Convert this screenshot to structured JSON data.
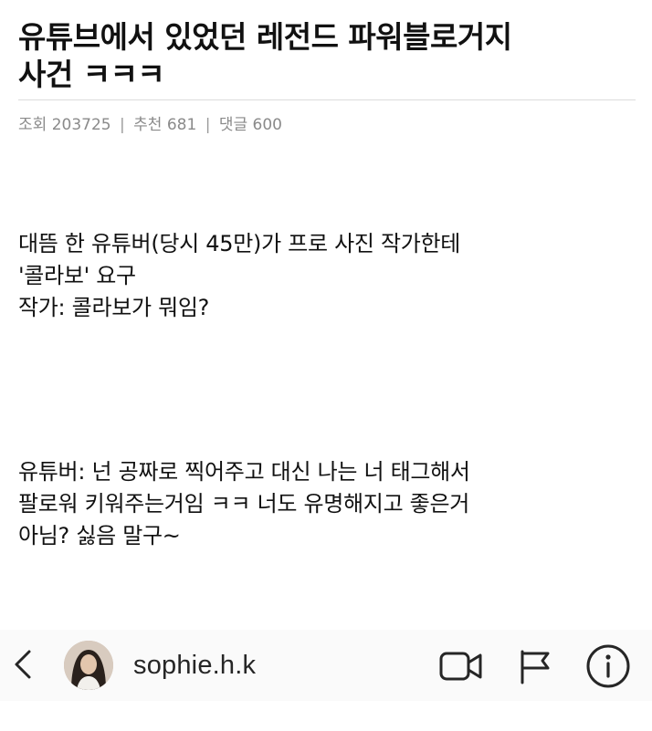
{
  "post": {
    "title_lines": [
      "유튜브에서 있었던 레전드 파워블로거지",
      "사건 ㅋㅋㅋ"
    ],
    "meta": {
      "views_label": "조회",
      "views": "203725",
      "recommend_label": "추천",
      "recommend": "681",
      "comments_label": "댓글",
      "comments": "600",
      "separator": "|"
    },
    "content": {
      "block1": [
        "대뜸 한 유튜버(당시 45만)가 프로 사진 작가한테",
        "'콜라보' 요구",
        "작가: 콜라보가 뭐임?"
      ],
      "block2": [
        "유튜버: 넌 공짜로 찍어주고 대신 나는 너 태그해서",
        "팔로워 키워주는거임 ㅋㅋ 너도 유명해지고 좋은거",
        "아님? 싫음 말구~"
      ]
    }
  },
  "instagram_bar": {
    "username": "sophie.h.k",
    "icons": {
      "back": "chevron-left-icon",
      "video": "video-call-icon",
      "flag": "flag-icon",
      "info": "info-icon"
    }
  },
  "colors": {
    "text": "#111111",
    "meta_text": "#8a8a8a",
    "divider": "#dcdcdc",
    "bar_background": "#fafafa",
    "icon": "#262626"
  }
}
